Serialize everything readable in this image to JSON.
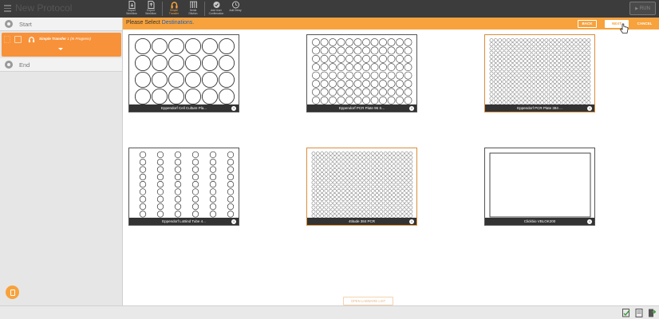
{
  "app": {
    "title": "New Protocol"
  },
  "toolbar": {
    "tools": [
      {
        "label": "Import\nWorkflow",
        "icon": "import-workflow-icon",
        "active": false
      },
      {
        "label": "Export\nWorkflow",
        "icon": "export-workflow-icon",
        "active": false
      },
      {
        "label": "Simple\nTransfer",
        "icon": "simple-transfer-icon",
        "active": true
      },
      {
        "label": "Serial\nDilution",
        "icon": "serial-dilution-icon",
        "active": false
      },
      {
        "label": "Add User\nConfirmation",
        "icon": "add-user-confirmation-icon",
        "active": false
      },
      {
        "label": "Add Delay",
        "icon": "add-delay-icon",
        "active": false
      }
    ],
    "run_label": "RUN"
  },
  "sidebar": {
    "start_label": "Start",
    "end_label": "End",
    "transfer": {
      "title": "Simple Transfer",
      "number": "1",
      "status": "(In Progress)"
    }
  },
  "header": {
    "prompt": "Please Select",
    "prompt_highlight": "Destinations.",
    "back_label": "BACK",
    "next_label": "NEXT",
    "cancel_label": "CANCEL"
  },
  "plates": [
    {
      "name": "Eppendorf Cell Culture Pla...",
      "kind": "24",
      "selected": false
    },
    {
      "name": "Eppendorf PCR Plate 96 S...",
      "kind": "96",
      "selected": false
    },
    {
      "name": "Eppendorf PCR Plate 384 ...",
      "kind": "384",
      "selected": true
    },
    {
      "name": "Eppendorf LoBind Tube 4...",
      "kind": "tubes",
      "selected": false
    },
    {
      "name": "4titude 384 PCR",
      "kind": "384",
      "selected": true
    },
    {
      "name": "Clickbio VBLOK200",
      "kind": "block",
      "selected": false
    }
  ],
  "open_button_label": "OPEN LABWARE LIST",
  "colors": {
    "accent": "#f7a23c",
    "topbar": "#3c3c3c",
    "highlight": "#1e5fbf"
  }
}
